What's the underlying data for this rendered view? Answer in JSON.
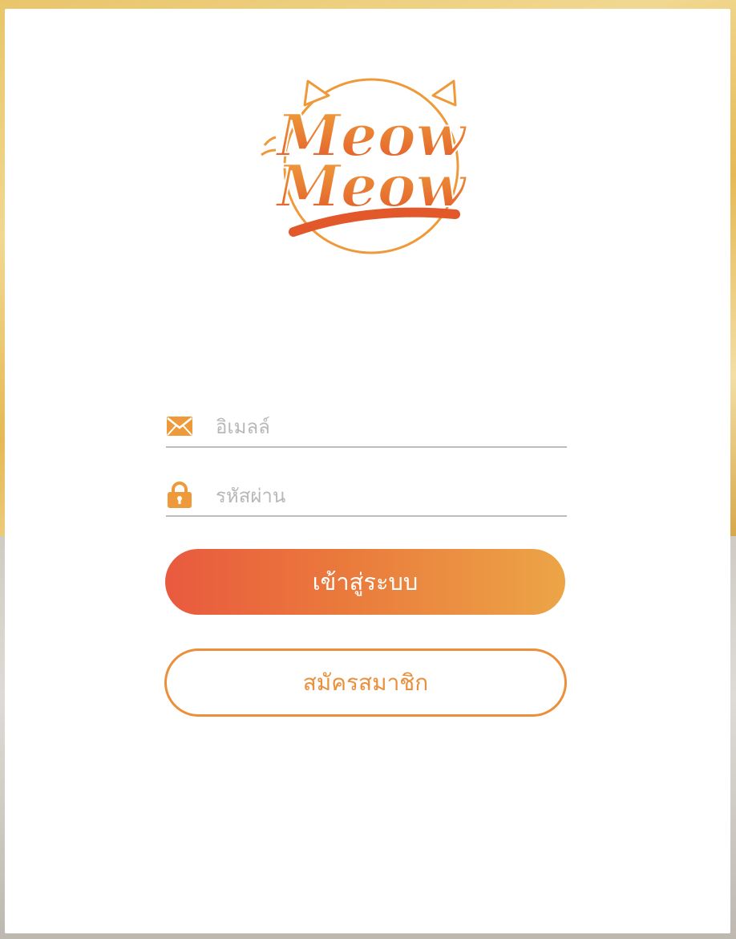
{
  "logo": {
    "line1": "Meow",
    "line2": "Meow"
  },
  "form": {
    "email": {
      "placeholder": "อิเมลล์",
      "value": "",
      "icon": "envelope-icon"
    },
    "password": {
      "placeholder": "รหัสผ่าน",
      "value": "",
      "icon": "lock-icon"
    }
  },
  "buttons": {
    "login_label": "เข้าสู่ระบบ",
    "register_label": "สมัครสมาชิก"
  },
  "colors": {
    "accent": "#ea8f3a",
    "gradient_start": "#e95a3f",
    "gradient_end": "#eca547",
    "underline": "#bdbdbd"
  }
}
